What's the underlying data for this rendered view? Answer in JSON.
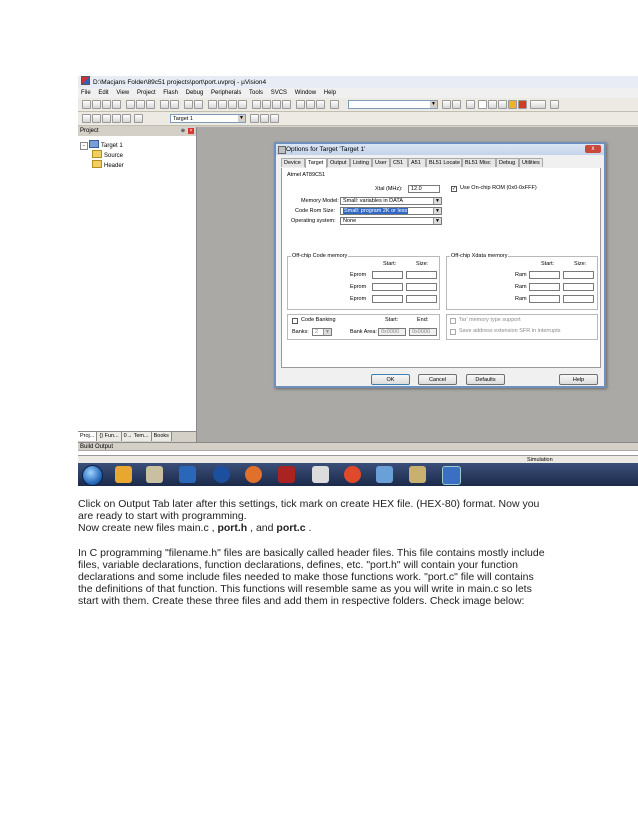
{
  "window": {
    "title": "D:\\Macjans Folder\\89c51 projects\\port\\port.uvproj - µVision4",
    "menu": [
      "File",
      "Edit",
      "View",
      "Project",
      "Flash",
      "Debug",
      "Peripherals",
      "Tools",
      "SVCS",
      "Window",
      "Help"
    ],
    "target_select": "Target 1"
  },
  "project_pane": {
    "title": "Project",
    "tree": {
      "root": "Target 1",
      "children": [
        "Source",
        "Header"
      ]
    },
    "tabs": [
      "Proj...",
      "{} Fun...",
      "0→ Tem...",
      "Books"
    ]
  },
  "build_output": {
    "title": "Build Output"
  },
  "status": {
    "mode": "Simulation"
  },
  "dialog": {
    "title": "Options for Target 'Target 1'",
    "close": "x",
    "tabs": [
      "Device",
      "Target",
      "Output",
      "Listing",
      "User",
      "C51",
      "A51",
      "BL51 Locate",
      "BL51 Misc",
      "Debug",
      "Utilities"
    ],
    "active_tab": "Target",
    "device": "Atmel AT89C51",
    "xtal_label": "Xtal (MHz):",
    "xtal_value": "12.0",
    "use_onchip_rom": "Use On-chip ROM (0x0-0xFFF)",
    "use_onchip_checked": "✓",
    "memory_model_label": "Memory Model:",
    "memory_model_value": "Small: variables in DATA",
    "code_rom_label": "Code Rom Size:",
    "code_rom_value": "Small: program 2K or less",
    "os_label": "Operating system:",
    "os_value": "None",
    "offchip_code": {
      "title": "Off-chip Code memory",
      "start": "Start:",
      "size": "Size:",
      "rows": [
        "Eprom",
        "Eprom",
        "Eprom"
      ]
    },
    "offchip_xdata": {
      "title": "Off-chip Xdata memory",
      "start": "Start:",
      "size": "Size:",
      "rows": [
        "Ram",
        "Ram",
        "Ram"
      ]
    },
    "code_banking": "Code Banking",
    "banks_label": "Banks:",
    "banks_value": "2",
    "bank_area_label": "Bank Area:",
    "bank_start_label": "Start:",
    "bank_end_label": "End:",
    "bank_start": "0x0000",
    "bank_end": "0x0000",
    "far_memory": "'far' memory type support",
    "save_sfr": "Save address extension SFR in interrupts",
    "buttons": {
      "ok": "OK",
      "cancel": "Cancel",
      "defaults": "Defaults",
      "help": "Help"
    }
  },
  "document": {
    "p1_line1": "Click on Output Tab later after this settings, tick mark on create HEX file. (HEX-80) format. Now you",
    "p1_line2": "are ready to start with programming.",
    "p2_prefix": "Now create new files main.c , ",
    "p2_file1": "port.h",
    "p2_mid": " , and ",
    "p2_file2": "port.c",
    "p2_end": " .",
    "p3_lines": [
      "In C programming \"filename.h\" files are basically called header files. This file contains mostly include",
      "files, variable declarations, function declarations, defines, etc. \"port.h\" will contain your function",
      "declarations and some include files needed to make those functions work. \"port.c\" file will contains",
      "the definitions of that function. This functions will resemble same as you will write in main.c so lets",
      "start with them. Create these three files and add them in respective folders. Check image below:"
    ]
  }
}
